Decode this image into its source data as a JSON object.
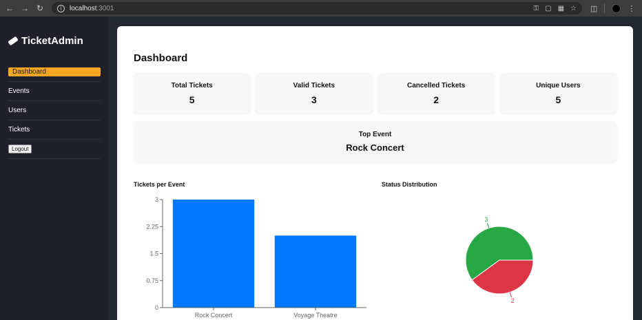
{
  "browser": {
    "url_host": "localhost",
    "url_port": ":3001"
  },
  "sidebar": {
    "brand": "TicketAdmin",
    "items": [
      {
        "label": "Dashboard"
      },
      {
        "label": "Events"
      },
      {
        "label": "Users"
      },
      {
        "label": "Tickets"
      }
    ],
    "logout_label": "Logout"
  },
  "dashboard": {
    "title": "Dashboard",
    "stats": [
      {
        "label": "Total Tickets",
        "value": "5"
      },
      {
        "label": "Valid Tickets",
        "value": "3"
      },
      {
        "label": "Cancelled Tickets",
        "value": "2"
      },
      {
        "label": "Unique Users",
        "value": "5"
      }
    ],
    "top_event": {
      "label": "Top Event",
      "value": "Rock Concert"
    }
  },
  "chart_data": [
    {
      "type": "bar",
      "title": "Tickets per Event",
      "categories": [
        "Rock Concert",
        "Voyage Theatre"
      ],
      "values": [
        3,
        2
      ],
      "ylim": [
        0,
        3
      ],
      "yticks": [
        "0",
        "0.75",
        "1.5",
        "2.25",
        "3"
      ],
      "color": "#0078ff"
    },
    {
      "type": "pie",
      "title": "Status Distribution",
      "labels": [
        "3",
        "2"
      ],
      "values": [
        3,
        2
      ],
      "colors": [
        "#28a745",
        "#dc3545"
      ]
    }
  ]
}
